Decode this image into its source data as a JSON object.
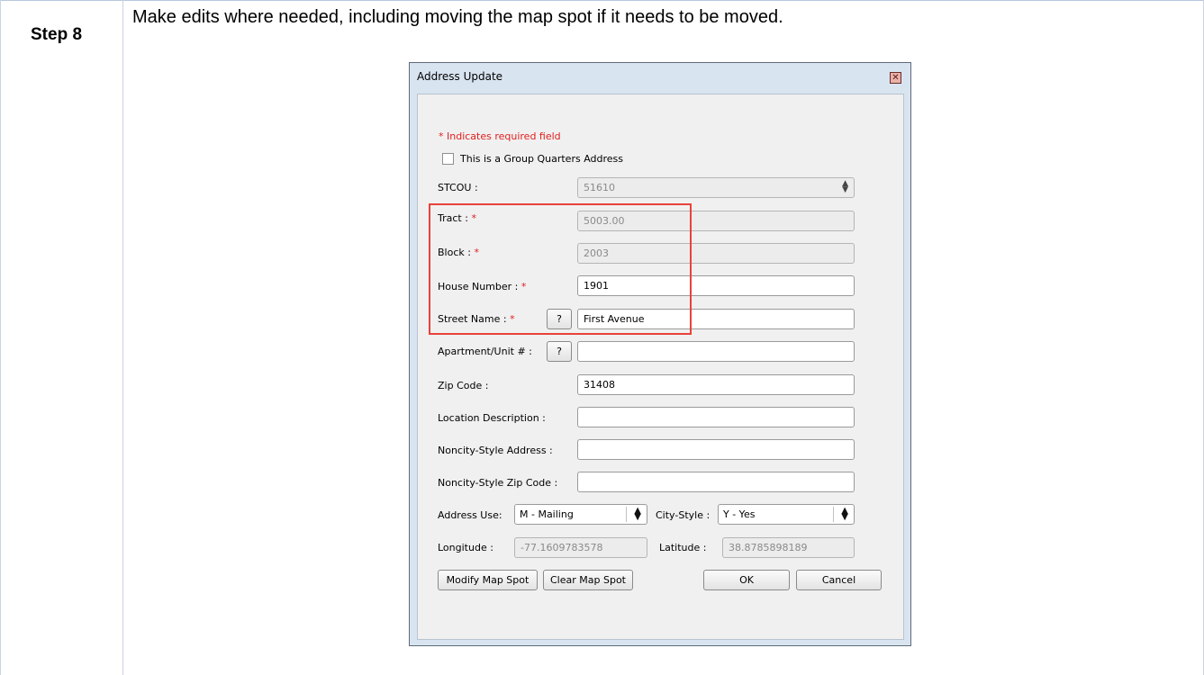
{
  "step_label": "Step 8",
  "instruction": "Make edits where needed, including moving the map spot if it needs to be moved.",
  "dialog": {
    "title": "Address Update",
    "close_glyph": "✕",
    "required_note": "* Indicates required field",
    "group_quarters_label": "This is a Group Quarters Address",
    "group_quarters_checked": false,
    "stcou": {
      "label": "STCOU :",
      "value": "51610"
    },
    "tract": {
      "label": "Tract :",
      "value": "5003.00"
    },
    "block": {
      "label": "Block :",
      "value": "2003"
    },
    "house_number": {
      "label": "House Number :",
      "value": "1901"
    },
    "street_name": {
      "label": "Street Name :",
      "help": "?",
      "value": "First Avenue"
    },
    "apartment": {
      "label": "Apartment/Unit # :",
      "help": "?",
      "value": ""
    },
    "zip_code": {
      "label": "Zip Code :",
      "value": "31408"
    },
    "location_description": {
      "label": "Location Description :",
      "value": ""
    },
    "noncity_address": {
      "label": "Noncity-Style Address :",
      "value": ""
    },
    "noncity_zip": {
      "label": "Noncity-Style Zip Code :",
      "value": ""
    },
    "address_use": {
      "label": "Address Use:",
      "value": "M - Mailing"
    },
    "city_style": {
      "label": "City-Style :",
      "value": "Y - Yes"
    },
    "longitude": {
      "label": "Longitude :",
      "value": "-77.1609783578"
    },
    "latitude": {
      "label": "Latitude :",
      "value": "38.8785898189"
    },
    "required_marker": "*",
    "buttons": {
      "modify_map_spot": "Modify Map Spot",
      "clear_map_spot": "Clear Map Spot",
      "ok": "OK",
      "cancel": "Cancel"
    }
  }
}
